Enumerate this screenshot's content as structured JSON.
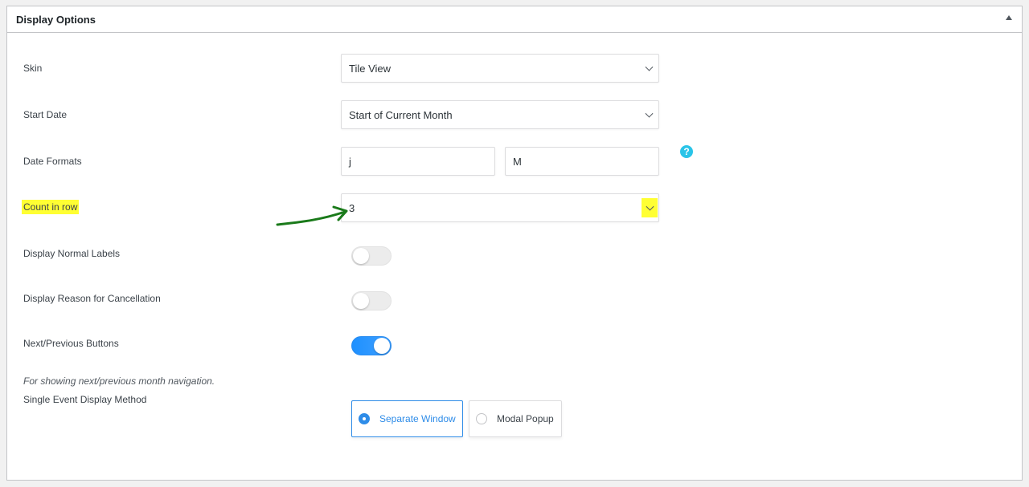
{
  "panel": {
    "title": "Display Options"
  },
  "form": {
    "skin": {
      "label": "Skin",
      "value": "Tile View"
    },
    "start_date": {
      "label": "Start Date",
      "value": "Start of Current Month"
    },
    "date_formats": {
      "label": "Date Formats",
      "value1": "j",
      "value2": "M"
    },
    "count_in_row": {
      "label": "Count in row",
      "value": "3"
    },
    "display_normal_labels": {
      "label": "Display Normal Labels",
      "enabled": false
    },
    "display_reason_cancellation": {
      "label": "Display Reason for Cancellation",
      "enabled": false
    },
    "next_previous_buttons": {
      "label": "Next/Previous Buttons",
      "enabled": true,
      "description": "For showing next/previous month navigation."
    },
    "single_event_display": {
      "label": "Single Event Display Method",
      "options": [
        "Separate Window",
        "Modal Popup"
      ],
      "selected": "Separate Window"
    }
  },
  "icons": {
    "help": "help-question-icon",
    "collapse": "collapse-up-icon",
    "annotation": "green-arrow-annotation"
  },
  "colors": {
    "accent": "#2e8ce8",
    "highlight": "#ffff33",
    "help": "#29c4e8",
    "annotation": "#1a7a1a"
  }
}
